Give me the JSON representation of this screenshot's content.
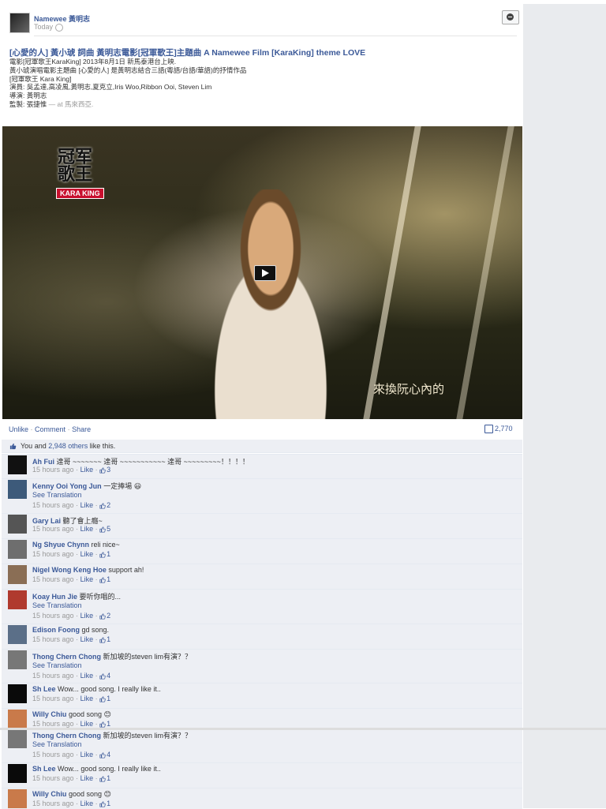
{
  "header": {
    "name": "Namewee 黃明志",
    "time": "Today",
    "title": "[心愛的人] 黃小琥 詞曲 黃明志電影[冠軍歌王]主題曲 A Namewee Film [KaraKing] theme LOVE",
    "body_lines": [
      "電影[冠軍歌王KaraKing] 2013年8月1日 新馬泰港台上映.",
      "黃小琥演唱電影主題曲 [心愛的人] 是黃明志結合三語(粵語/台語/華語)的抒情作品",
      "",
      "[冠軍歌王 Kara King]",
      "演員: 吳孟達,高凌風,黃明志,夏克立,Iris Woo,Ribbon Ooi, Steven Lim",
      "導演: 黃明志",
      "監製: 張捷惟"
    ],
    "location_prefix": "— at",
    "location": "馬來西亞."
  },
  "video": {
    "logo_title": "冠军\n歌王",
    "logo_badge": "KARA KING",
    "subtitle": "來換阮心內的"
  },
  "actions": {
    "unlike": "Unlike",
    "comment": "Comment",
    "share": "Share",
    "sep": "·",
    "share_count": "2,770"
  },
  "likes": {
    "you_and": "You and",
    "others": "2,948 others",
    "like_this": "like this."
  },
  "comments": [
    {
      "name": "Ah Fui",
      "text": "達哥 ~~~~~~~ 達哥 ~~~~~~~~~~~ 達哥 ~~~~~~~~~！！！！",
      "translation": "",
      "time": "15 hours ago",
      "likes": "3",
      "avatar": "#111111"
    },
    {
      "name": "Kenny Ooi Yong Jun",
      "text": "一定捧場 😃",
      "translation": "See Translation",
      "time": "15 hours ago",
      "likes": "2",
      "avatar": "#3d5a7a"
    },
    {
      "name": "Gary Lai",
      "text": "聽了會上癮~",
      "translation": "",
      "time": "15 hours ago",
      "likes": "5",
      "avatar": "#555555"
    },
    {
      "name": "Ng Shyue Chynn",
      "text": "reli nice~",
      "translation": "",
      "time": "15 hours ago",
      "likes": "1",
      "avatar": "#6e6e6e"
    },
    {
      "name": "Nigel Wong Keng Hoe",
      "text": "support ah!",
      "translation": "",
      "time": "15 hours ago",
      "likes": "1",
      "avatar": "#8a6e55"
    },
    {
      "name": "Koay Hun Jie",
      "text": "要听你唱的...",
      "translation": "See Translation",
      "time": "15 hours ago",
      "likes": "2",
      "avatar": "#b03a2e"
    },
    {
      "name": "Edison Foong",
      "text": "gd song.",
      "translation": "",
      "time": "15 hours ago",
      "likes": "1",
      "avatar": "#5b6f88"
    },
    {
      "name": "Thong Chern Chong",
      "text": "新加坡的steven lim有演？？",
      "translation": "See Translation",
      "time": "15 hours ago",
      "likes": "4",
      "avatar": "#777777"
    },
    {
      "name": "Sh Lee",
      "text": "Wow... good song. I really like it..",
      "translation": "",
      "time": "15 hours ago",
      "likes": "1",
      "avatar": "#0a0a0a"
    },
    {
      "name": "Willy Chiu",
      "text": "good song 😊",
      "translation": "",
      "time": "15 hours ago",
      "likes": "1",
      "avatar": "#c97a4a"
    },
    {
      "name": "Thong Chern Chong",
      "text": "新加坡的steven lim有演？？",
      "translation": "See Translation",
      "time": "15 hours ago",
      "likes": "4",
      "avatar": "#777777"
    },
    {
      "name": "Sh Lee",
      "text": "Wow... good song. I really like it..",
      "translation": "",
      "time": "15 hours ago",
      "likes": "1",
      "avatar": "#0a0a0a"
    },
    {
      "name": "Willy Chiu",
      "text": "good song 😊",
      "translation": "",
      "time": "15 hours ago",
      "likes": "1",
      "avatar": "#c97a4a"
    }
  ],
  "comment_meta": {
    "sep": "·",
    "like": "Like"
  },
  "colors": {
    "link": "#3b5998",
    "comment_bg": "#edeff4",
    "sidebar": "#e9ebee"
  }
}
